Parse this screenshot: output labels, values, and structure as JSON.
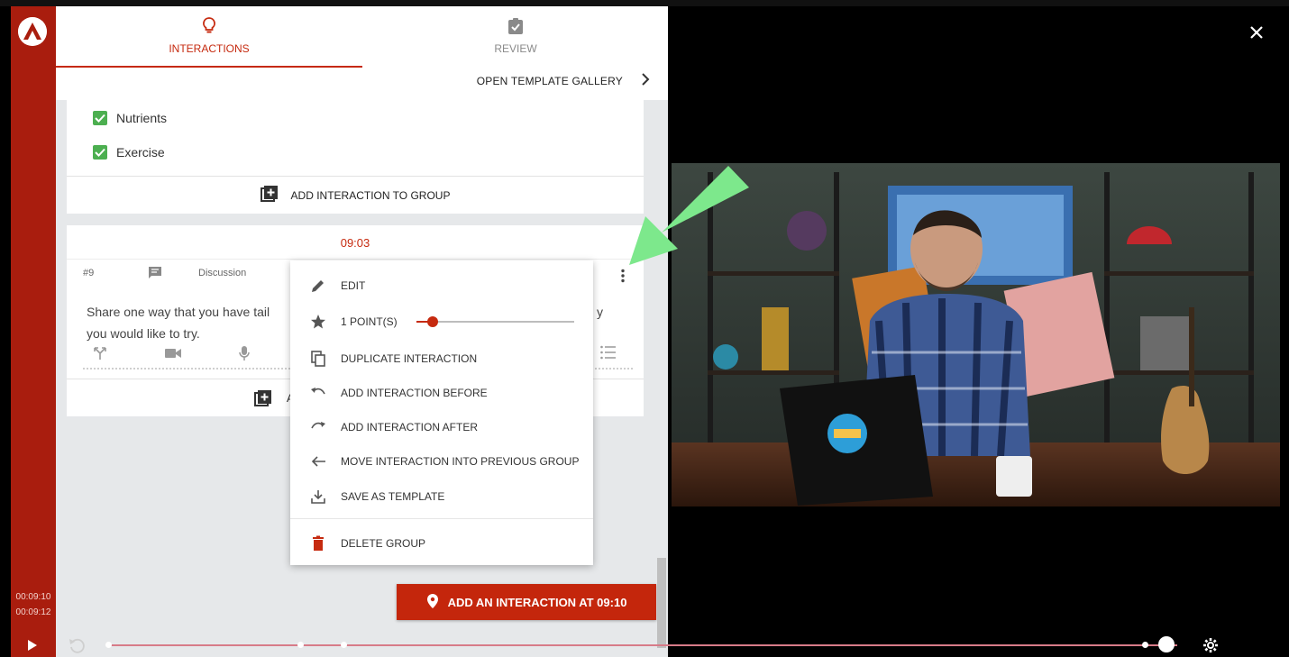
{
  "app": {
    "rail_time_current": "00:09:10",
    "rail_time_total": "00:09:12"
  },
  "tabs": [
    {
      "label": "INTERACTIONS",
      "icon": "lightbulb-icon",
      "active": true
    },
    {
      "label": "REVIEW",
      "icon": "clipboard-check-icon",
      "active": false
    }
  ],
  "gallery": {
    "label": "OPEN TEMPLATE GALLERY"
  },
  "group1": {
    "options": [
      {
        "label": "Nutrients",
        "checked": true
      },
      {
        "label": "Exercise",
        "checked": true
      }
    ],
    "add_label": "ADD INTERACTION TO GROUP"
  },
  "group2": {
    "time": "09:03",
    "number": "#9",
    "type": "Discussion",
    "question_line1": "Share one way that you have tail",
    "question_line1_end": "y",
    "question_line2": "you would like to try.",
    "add_label_partial": "A"
  },
  "menu": {
    "items": [
      {
        "label": "EDIT",
        "icon": "pencil-icon"
      },
      {
        "label": "1 POINT(S)",
        "icon": "star-icon"
      },
      {
        "label": "DUPLICATE INTERACTION",
        "icon": "duplicate-icon"
      },
      {
        "label": "ADD INTERACTION BEFORE",
        "icon": "undo-arrow-icon"
      },
      {
        "label": "ADD INTERACTION AFTER",
        "icon": "redo-arrow-icon"
      },
      {
        "label": "MOVE INTERACTION INTO PREVIOUS GROUP",
        "icon": "arrow-left-icon"
      },
      {
        "label": "SAVE AS TEMPLATE",
        "icon": "download-icon"
      },
      {
        "label": "DELETE GROUP",
        "icon": "trash-icon"
      }
    ],
    "points_slider_level": 0.1
  },
  "add_interaction_button": {
    "label": "ADD AN INTERACTION AT 09:10"
  },
  "colors": {
    "brand_red": "#a91d0e",
    "accent_red": "#c62a0f",
    "check_green": "#4caf50",
    "arrow_green": "#7de88c"
  },
  "player": {
    "progress": 0.99,
    "markers": [
      0.0,
      0.18,
      0.22,
      0.97
    ]
  }
}
